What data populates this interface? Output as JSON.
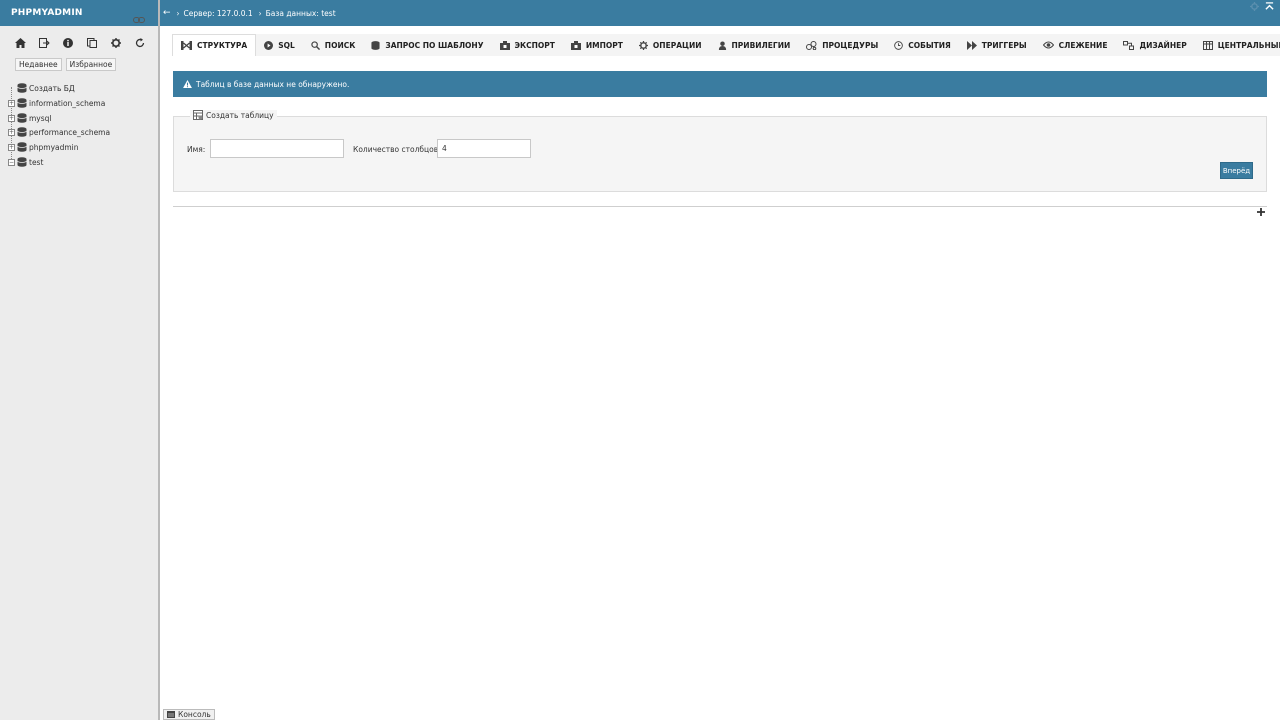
{
  "app": {
    "logo": "PHPMYADMIN"
  },
  "sidebar": {
    "nav_icons": [
      "home-icon",
      "logout-icon",
      "info-icon",
      "docs-icon",
      "settings-icon",
      "reload-icon"
    ],
    "tabs": {
      "recent": "Недавнее",
      "favorites": "Избранное"
    },
    "tree": [
      {
        "label": "Создать БД",
        "expandable": false
      },
      {
        "label": "information_schema",
        "expandable": true
      },
      {
        "label": "mysql",
        "expandable": true
      },
      {
        "label": "performance_schema",
        "expandable": true
      },
      {
        "label": "phpmyadmin",
        "expandable": true
      },
      {
        "label": "test",
        "expandable": true
      }
    ]
  },
  "breadcrumb": {
    "server": "Сервер: 127.0.0.1",
    "database": "База данных: test"
  },
  "tabs": [
    {
      "label": "Структура",
      "icon": "structure-icon",
      "active": true
    },
    {
      "label": "SQL",
      "icon": "sql-icon"
    },
    {
      "label": "Поиск",
      "icon": "search-icon"
    },
    {
      "label": "Запрос по шаблону",
      "icon": "query-icon"
    },
    {
      "label": "Экспорт",
      "icon": "export-icon"
    },
    {
      "label": "Импорт",
      "icon": "import-icon"
    },
    {
      "label": "Операции",
      "icon": "operations-icon"
    },
    {
      "label": "Привилегии",
      "icon": "privileges-icon"
    },
    {
      "label": "Процедуры",
      "icon": "routines-icon"
    },
    {
      "label": "События",
      "icon": "events-icon"
    },
    {
      "label": "Триггеры",
      "icon": "triggers-icon"
    },
    {
      "label": "Слежение",
      "icon": "tracking-icon"
    },
    {
      "label": "Дизайнер",
      "icon": "designer-icon"
    },
    {
      "label": "Центральные столбцы",
      "icon": "central-columns-icon"
    }
  ],
  "alert": {
    "text": "Таблиц в базе данных не обнаружено."
  },
  "create_table": {
    "legend": "Создать таблицу",
    "name_label": "Имя:",
    "name_value": "",
    "columns_label": "Количество столбцов:",
    "columns_value": "4",
    "go_label": "Вперёд"
  },
  "console": {
    "label": "Консоль"
  },
  "colors": {
    "brand": "#3a7ca0",
    "sidebar_bg": "#ececec",
    "tabs_bg": "#f4f4f4"
  }
}
